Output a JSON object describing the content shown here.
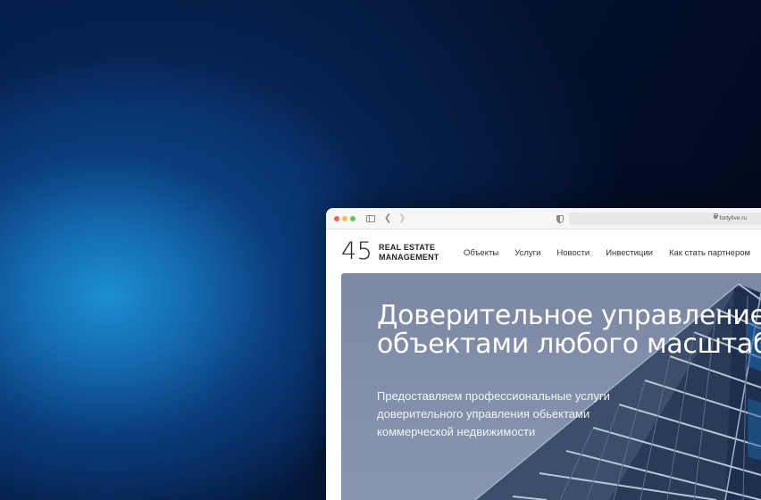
{
  "browser": {
    "url": "fortyfive.ru"
  },
  "site": {
    "logo_number": "45",
    "logo_line1": "REAL ESTATE",
    "logo_line2": "MANAGEMENT",
    "nav": [
      "Объекты",
      "Услуги",
      "Новости",
      "Инвестиции",
      "Как стать партнером"
    ]
  },
  "hero": {
    "title_line1": "Доверительное управление",
    "title_line2": "объектами любого масштаба",
    "subtitle_line1": "Предоставляем профессиональные услуги",
    "subtitle_line2": "доверительного управления обьектами",
    "subtitle_line3": "коммерческой недвижимости"
  },
  "colors": {
    "background_accent": "#1c8fd0",
    "hero_bg": "#818ea9",
    "text_dark": "#222222"
  },
  "icons": [
    "close-dot",
    "minimize-dot",
    "maximize-dot",
    "sidebar-icon",
    "back-icon",
    "forward-icon",
    "shield-icon",
    "lock-icon"
  ]
}
